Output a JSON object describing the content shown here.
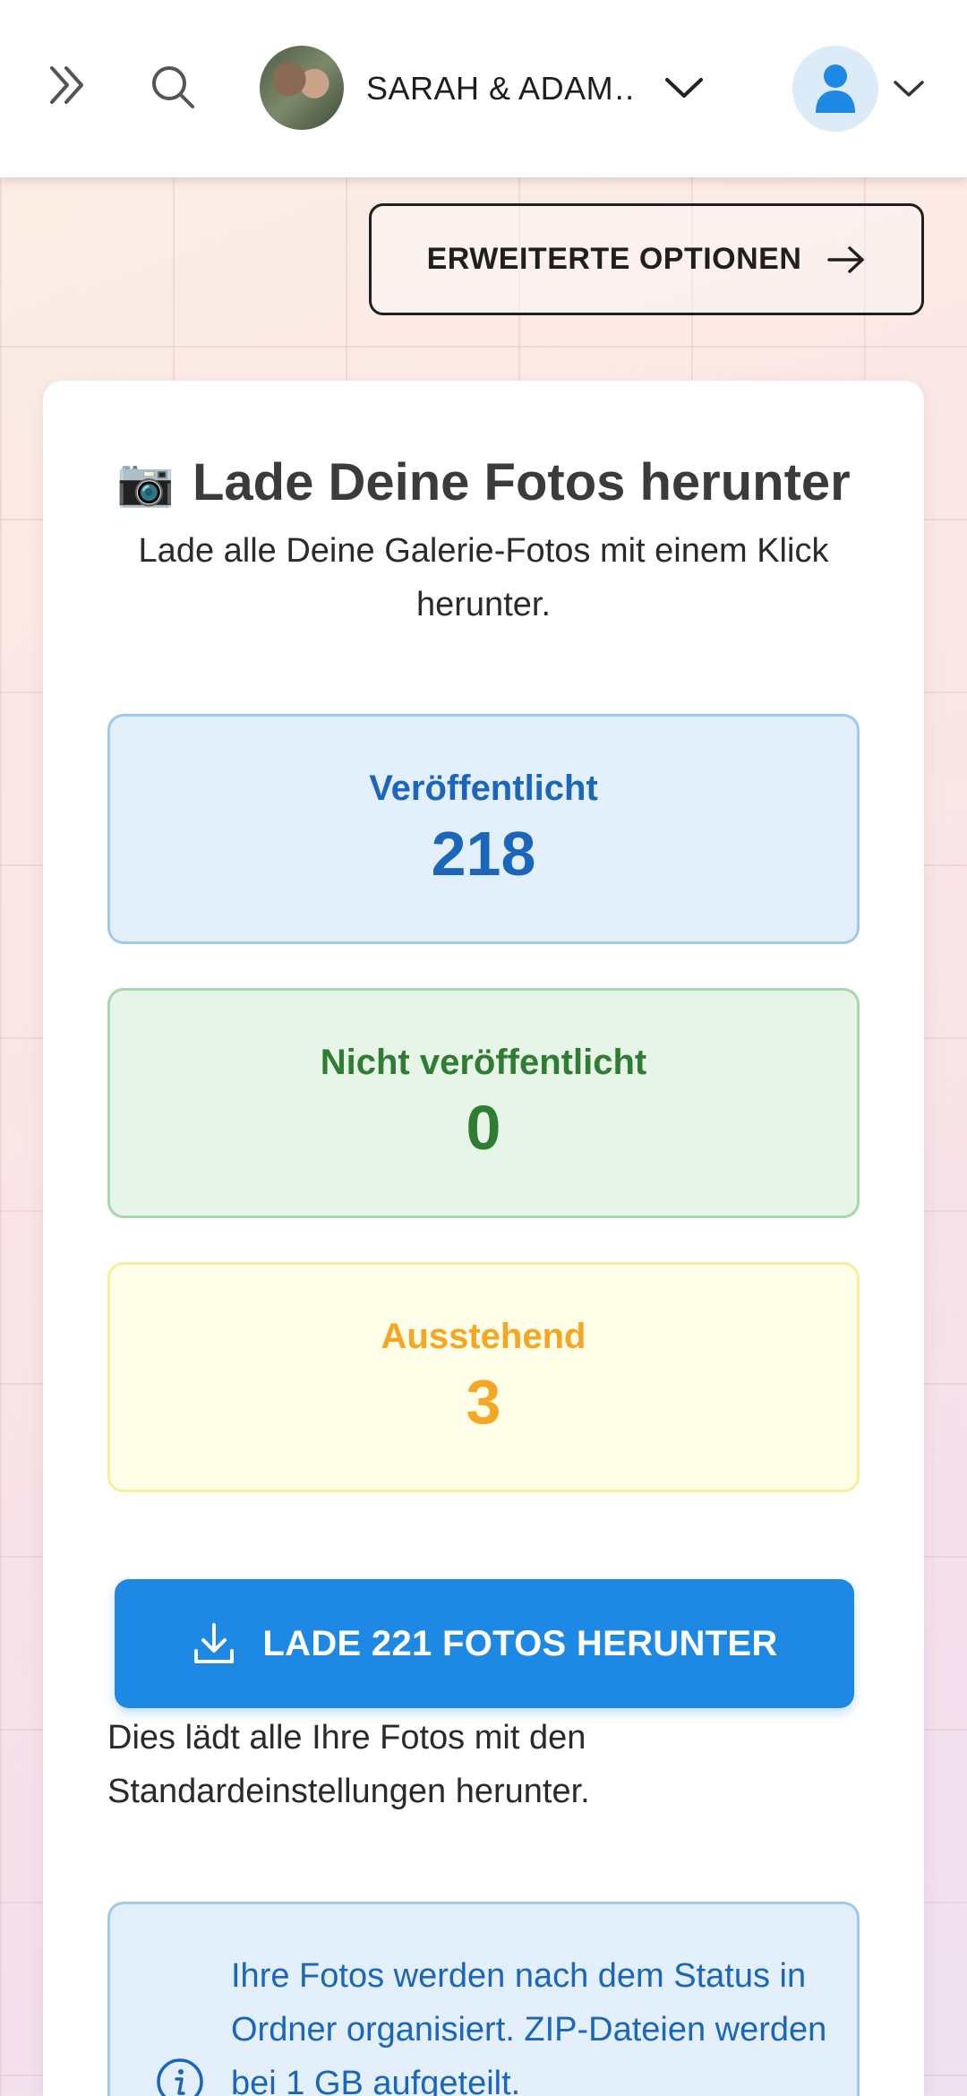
{
  "header": {
    "gallery_name": "SARAH & ADAM…",
    "icons": {
      "menu": "double-chevron-right-icon",
      "search": "search-icon",
      "gallery_dropdown": "chevron-down-icon",
      "user": "user-icon",
      "user_dropdown": "chevron-down-icon"
    }
  },
  "advanced_options": {
    "label": "ERWEITERTE OPTIONEN",
    "icon": "arrow-right-icon"
  },
  "card": {
    "icon": "📷",
    "title": "Lade Deine Fotos herunter",
    "subtitle": "Lade alle Deine Galerie-Fotos mit einem Klick herunter.",
    "stats": [
      {
        "label": "Veröffentlicht",
        "value": "218",
        "color": "#1a66bd"
      },
      {
        "label": "Nicht veröffentlicht",
        "value": "0",
        "color": "#2e7d32"
      },
      {
        "label": "Ausstehend",
        "value": "3",
        "color": "#f5a623"
      }
    ],
    "download_button": {
      "label": "LADE 221 FOTOS HERUNTER",
      "icon": "download-icon",
      "color": "#1e88e5"
    },
    "download_note": "Dies lädt alle Ihre Fotos mit den Standardeinstellungen herunter.",
    "info": {
      "icon": "info-icon",
      "text": "Ihre Fotos werden nach dem Status in Ordner organisiert. ZIP-Dateien werden bei 1 GB aufgeteilt."
    }
  }
}
